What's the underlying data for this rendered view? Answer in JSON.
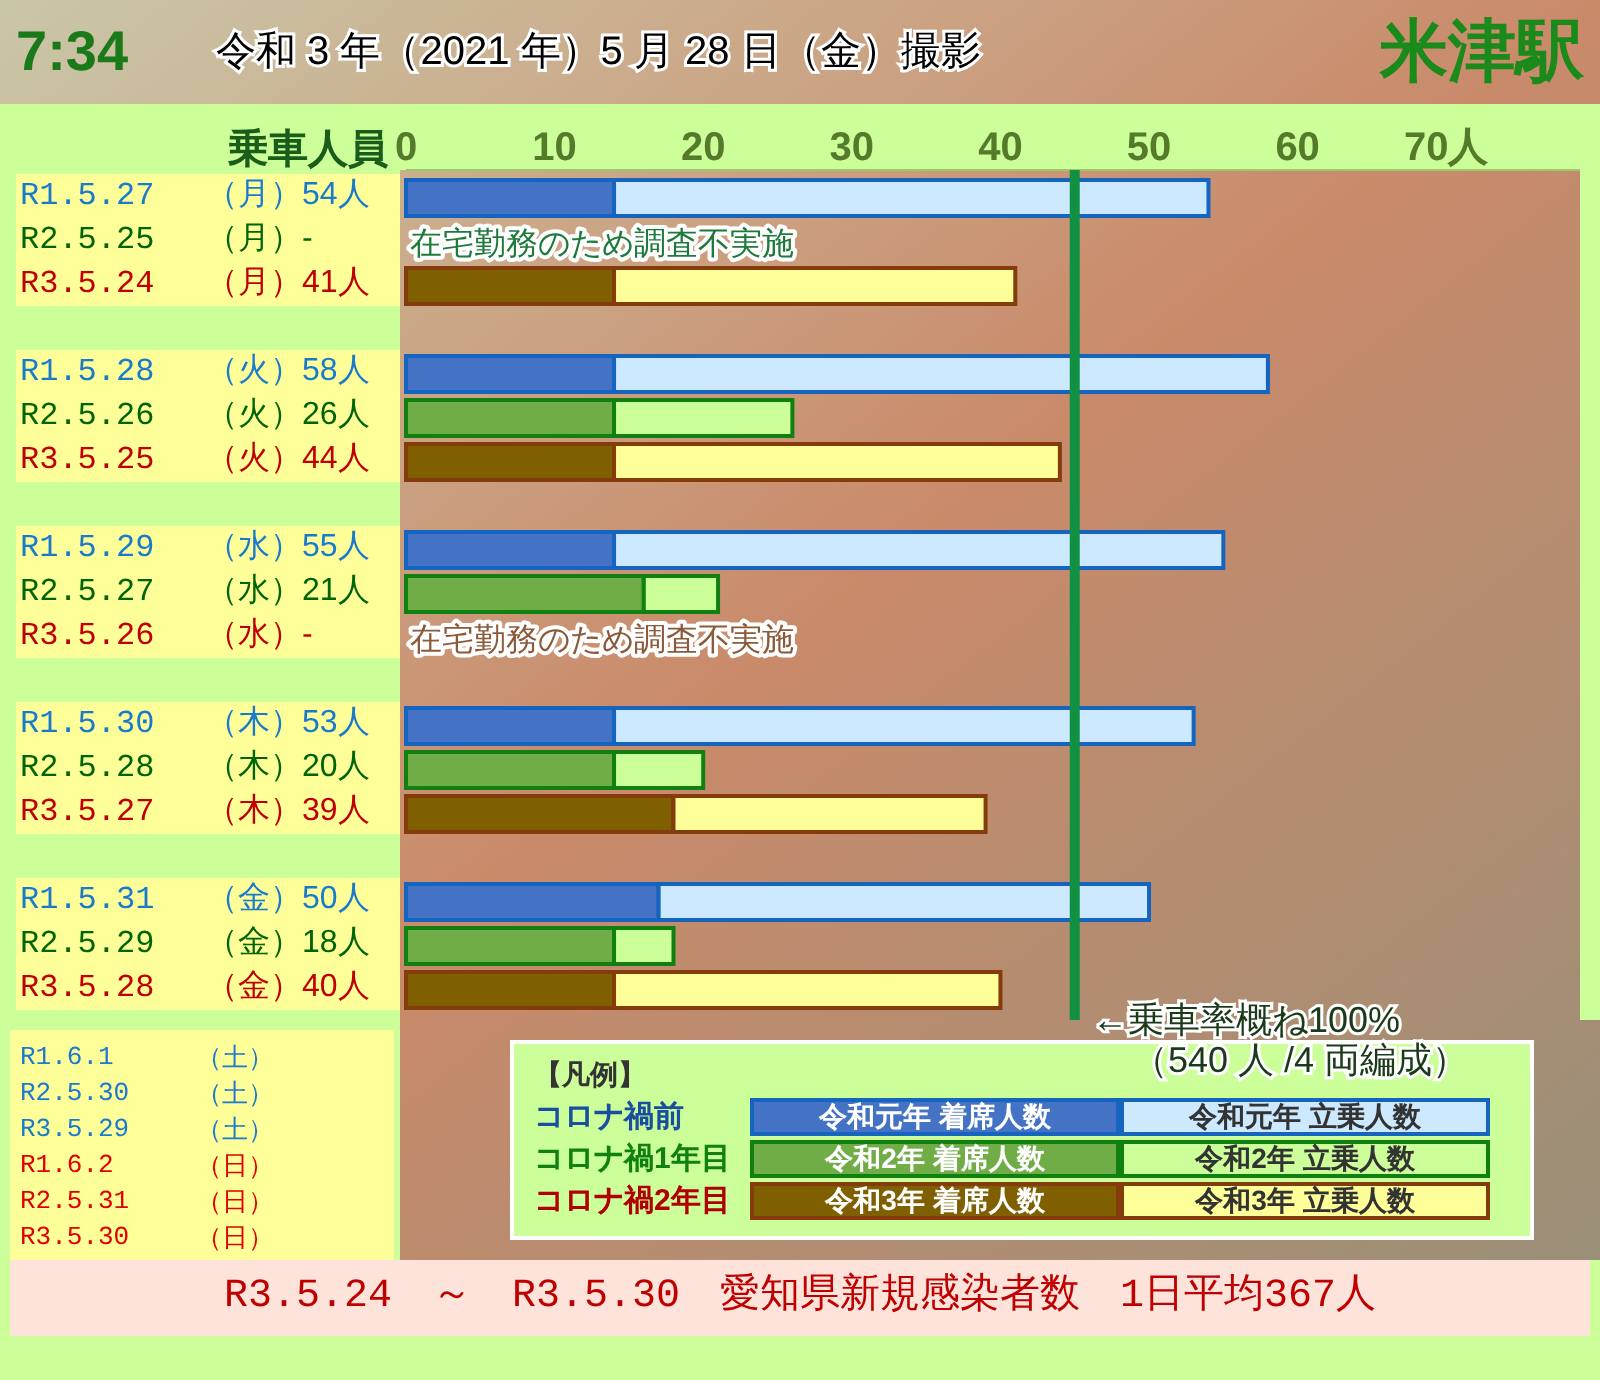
{
  "header": {
    "time": "7:34",
    "caption": "令和 3 年（2021 年）5 月 28 日（金）撮影",
    "station": "米津駅"
  },
  "chart_data": {
    "type": "bar",
    "orientation": "horizontal",
    "stacked": true,
    "xlabel": "乗車人員",
    "categories": [
      "R1.5.27",
      "R2.5.25",
      "R3.5.24",
      "R1.5.28",
      "R2.5.26",
      "R3.5.25",
      "R1.5.29",
      "R2.5.27",
      "R3.5.26",
      "R1.5.30",
      "R2.5.28",
      "R3.5.27",
      "R1.5.31",
      "R2.5.29",
      "R3.5.28"
    ],
    "series": [
      {
        "name": "令和元年 着席人数",
        "color": "#4472c4",
        "values": [
          14,
          null,
          null,
          14,
          null,
          null,
          14,
          null,
          null,
          14,
          null,
          null,
          17,
          null,
          null
        ]
      },
      {
        "name": "令和元年 立乗人数",
        "color": "#cce9ff",
        "values": [
          40,
          null,
          null,
          44,
          null,
          null,
          41,
          null,
          null,
          39,
          null,
          null,
          33,
          null,
          null
        ]
      },
      {
        "name": "令和2年 着席人数",
        "color": "#70ad47",
        "values": [
          null,
          null,
          null,
          null,
          14,
          null,
          null,
          16,
          null,
          null,
          14,
          null,
          null,
          14,
          null
        ]
      },
      {
        "name": "令和2年 立乗人数",
        "color": "#ccff99",
        "values": [
          null,
          null,
          null,
          null,
          12,
          null,
          null,
          5,
          null,
          null,
          6,
          null,
          null,
          4,
          null
        ]
      },
      {
        "name": "令和3年 着席人数",
        "color": "#7f5f00",
        "values": [
          null,
          null,
          14,
          null,
          null,
          14,
          null,
          null,
          null,
          null,
          null,
          18,
          null,
          null,
          14
        ]
      },
      {
        "name": "令和3年 立乗人数",
        "color": "#ffff99",
        "values": [
          null,
          null,
          27,
          null,
          null,
          30,
          null,
          null,
          null,
          null,
          null,
          21,
          null,
          null,
          26
        ]
      }
    ],
    "xticks": [
      0,
      10,
      20,
      30,
      40,
      50,
      60,
      {
        "value": 70,
        "label": "70人"
      }
    ],
    "xlim": [
      0,
      79
    ],
    "ref_lines": [
      {
        "axis": "x",
        "value": 45,
        "color": "#109040"
      }
    ]
  },
  "capacity_note": [
    "←乗車率概ね100%",
    "（540 人 /4 両編成）"
  ],
  "rows": [
    {
      "day": "（月）",
      "count": "54人",
      "color": "#1a7acc"
    },
    {
      "day": "（月）",
      "count": "-",
      "color": "#006400",
      "note": {
        "text": "在宅勤務のため調査不実施",
        "color": "#1e7a3a"
      }
    },
    {
      "day": "（月）",
      "count": "41人",
      "color": "#c00000"
    },
    {
      "day": "（火）",
      "count": "58人",
      "color": "#1a7acc"
    },
    {
      "day": "（火）",
      "count": "26人",
      "color": "#006400"
    },
    {
      "day": "（火）",
      "count": "44人",
      "color": "#c00000"
    },
    {
      "day": "（水）",
      "count": "55人",
      "color": "#1a7acc"
    },
    {
      "day": "（水）",
      "count": "21人",
      "color": "#006400"
    },
    {
      "day": "（水）",
      "count": "-",
      "color": "#c00000",
      "note": {
        "text": "在宅勤務のため調査不実施",
        "color": "#8a5a3a"
      }
    },
    {
      "day": "（木）",
      "count": "53人",
      "color": "#1a7acc"
    },
    {
      "day": "（木）",
      "count": "20人",
      "color": "#006400"
    },
    {
      "day": "（木）",
      "count": "39人",
      "color": "#c00000"
    },
    {
      "day": "（金）",
      "count": "50人",
      "color": "#1a7acc"
    },
    {
      "day": "（金）",
      "count": "18人",
      "color": "#006400"
    },
    {
      "day": "（金）",
      "count": "40人",
      "color": "#c00000"
    }
  ],
  "weekend": [
    {
      "date": "R1.6.1",
      "day": "（土）",
      "color": "#1a7acc"
    },
    {
      "date": "R2.5.30",
      "day": "（土）",
      "color": "#1a7acc"
    },
    {
      "date": "R3.5.29",
      "day": "（土）",
      "color": "#1a7acc"
    },
    {
      "date": "R1.6.2",
      "day": "（日）",
      "color": "#e00000"
    },
    {
      "date": "R2.5.31",
      "day": "（日）",
      "color": "#e00000"
    },
    {
      "date": "R3.5.30",
      "day": "（日）",
      "color": "#e00000"
    }
  ],
  "legend": {
    "title": "【凡例】",
    "groups": [
      {
        "label": "コロナ禍前",
        "color": "#1a4fa0"
      },
      {
        "label": "コロナ禍1年目",
        "color": "#108010"
      },
      {
        "label": "コロナ禍2年目",
        "color": "#b00000"
      }
    ]
  },
  "footer": "R3.5.24　～　R3.5.30　愛知県新規感染者数　1日平均367人"
}
